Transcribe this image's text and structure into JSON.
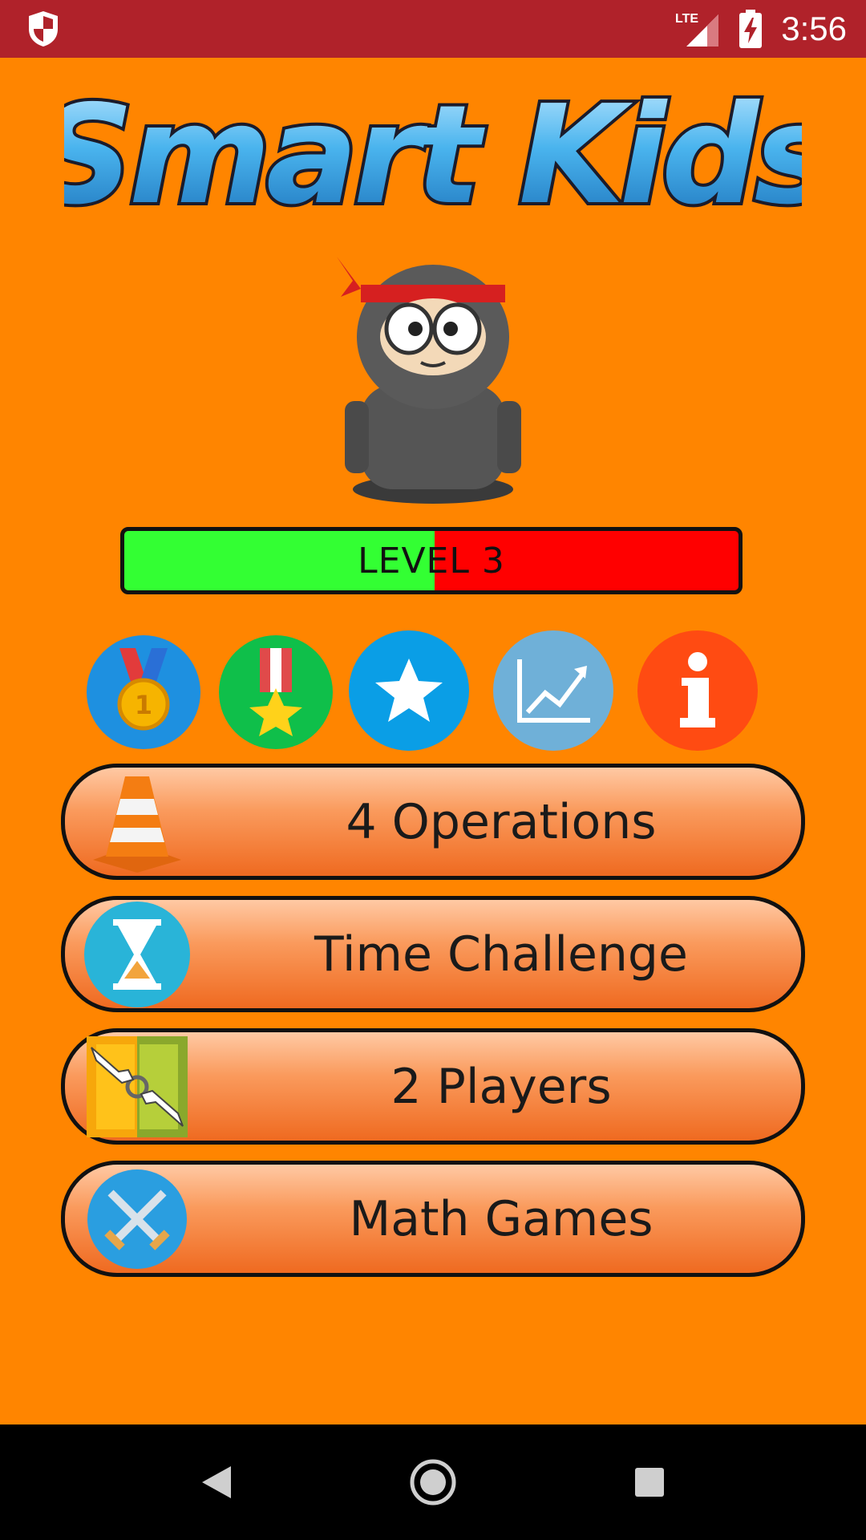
{
  "status_bar": {
    "network": "LTE",
    "time": "3:56"
  },
  "app": {
    "logo_text": "Smart Kids"
  },
  "level": {
    "label": "LEVEL 3",
    "progress": 0.505
  },
  "quick_actions": [
    {
      "name": "medal-icon",
      "color": "#1e90e0"
    },
    {
      "name": "award-ribbon-icon",
      "color": "#0fbf4a"
    },
    {
      "name": "star-icon",
      "color": "#0a9ee6"
    },
    {
      "name": "stats-chart-icon",
      "color": "#6fb0d8"
    },
    {
      "name": "info-icon",
      "color": "#ff4b12"
    }
  ],
  "menu": [
    {
      "label": "4 Operations",
      "icon": "traffic-cone-icon"
    },
    {
      "label": "Time Challenge",
      "icon": "hourglass-icon"
    },
    {
      "label": "2 Players",
      "icon": "two-hands-icon"
    },
    {
      "label": "Math Games",
      "icon": "crossed-swords-icon"
    }
  ],
  "colors": {
    "background": "#ff8500",
    "status_bar": "#b0222a",
    "level_done": "#33ff33",
    "level_remaining": "#ff0000"
  }
}
